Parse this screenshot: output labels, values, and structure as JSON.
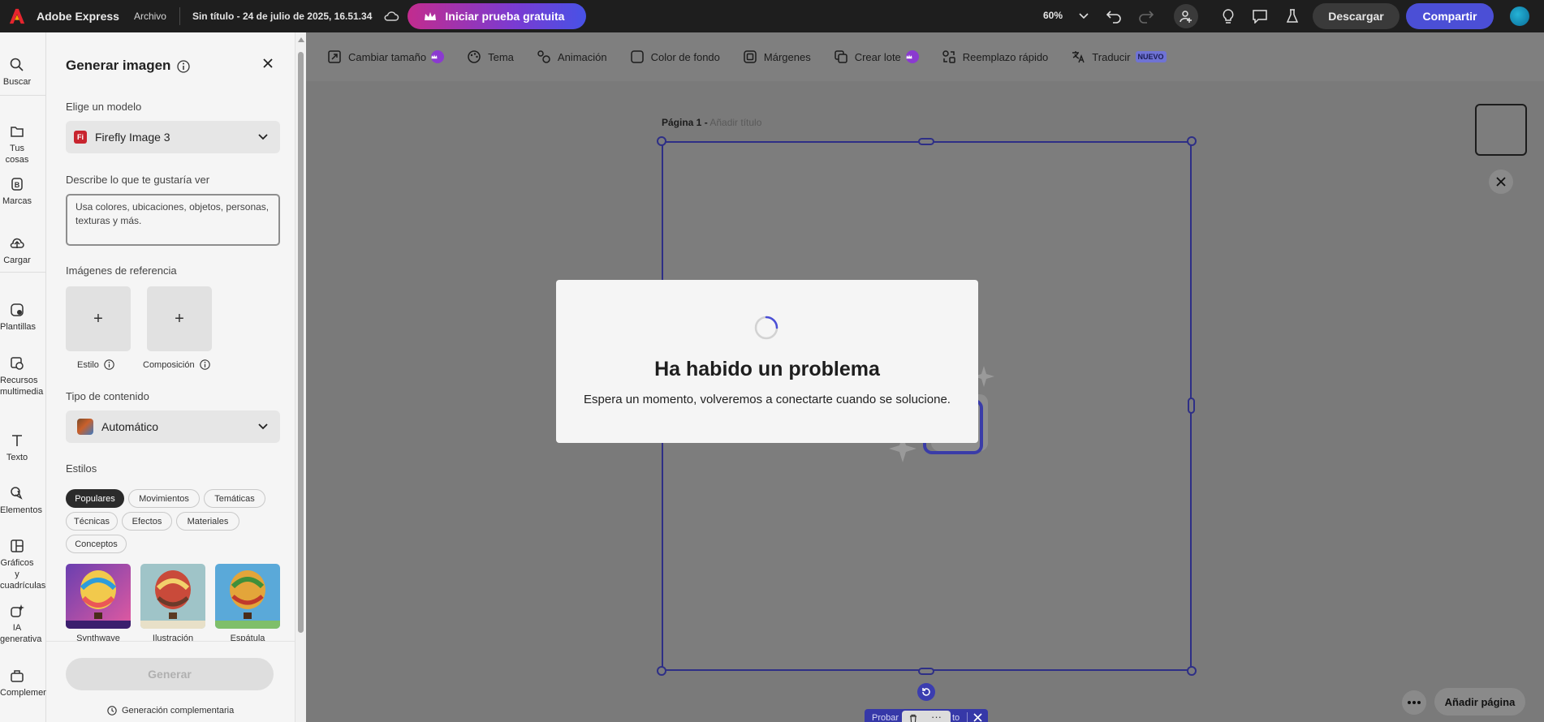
{
  "topbar": {
    "app_name": "Adobe Express",
    "file_menu": "Archivo",
    "doc_title": "Sin título - 24 de julio de 2025, 16.51.34",
    "trial_button": "Iniciar prueba gratuita",
    "zoom": "60%",
    "download": "Descargar",
    "share": "Compartir"
  },
  "rail": {
    "items": [
      {
        "label": "Buscar",
        "icon": "search-icon"
      },
      {
        "label": "Tus cosas",
        "icon": "folder-icon"
      },
      {
        "label": "Marcas",
        "icon": "brand-icon"
      },
      {
        "label": "Cargar",
        "icon": "upload-icon"
      },
      {
        "label": "Plantillas",
        "icon": "templates-icon"
      },
      {
        "label": "Recursos multimedia",
        "icon": "media-icon"
      },
      {
        "label": "Texto",
        "icon": "text-icon"
      },
      {
        "label": "Elementos",
        "icon": "elements-icon"
      },
      {
        "label": "Gráficos y cuadrículas",
        "icon": "grid-icon"
      },
      {
        "label": "IA generativa",
        "icon": "ai-icon"
      },
      {
        "label": "Complementos",
        "icon": "addons-icon"
      }
    ]
  },
  "panel": {
    "title": "Generar imagen",
    "model_label": "Elige un modelo",
    "model_badge": "Fi",
    "model_value": "Firefly Image 3",
    "prompt_label": "Describe lo que te gustaría ver",
    "prompt_placeholder": "Usa colores, ubicaciones, objetos, personas, texturas y más.",
    "reference_label": "Imágenes de referencia",
    "reference_style": "Estilo",
    "reference_composition": "Composición",
    "content_type_label": "Tipo de contenido",
    "content_type_value": "Automático",
    "styles_label": "Estilos",
    "style_chips": [
      "Populares",
      "Movimientos",
      "Temáticas",
      "Técnicas",
      "Efectos",
      "Materiales",
      "Conceptos"
    ],
    "style_cards": [
      "Synthwave",
      "Ilustración",
      "Espátula"
    ],
    "generate_button": "Generar",
    "complementary": "Generación complementaria"
  },
  "toolbar": {
    "resize": "Cambiar tamaño",
    "theme": "Tema",
    "animation": "Animación",
    "bg_color": "Color de fondo",
    "margins": "Márgenes",
    "batch": "Crear lote",
    "quick_replace": "Reemplazo rápido",
    "translate": "Traducir",
    "new_badge": "NUEVO"
  },
  "canvas": {
    "page_label": "Página 1 -",
    "add_title": "Añadir título",
    "ctx_left": "Probar",
    "ctx_right": "to",
    "add_page": "Añadir página"
  },
  "dialog": {
    "title": "Ha habido un problema",
    "message": "Espera un momento, volveremos a conectarte cuando se solucione."
  },
  "colors": {
    "accent": "#4b4fd6",
    "selection": "#2e2f86",
    "topbar": "#1e1e1e"
  }
}
